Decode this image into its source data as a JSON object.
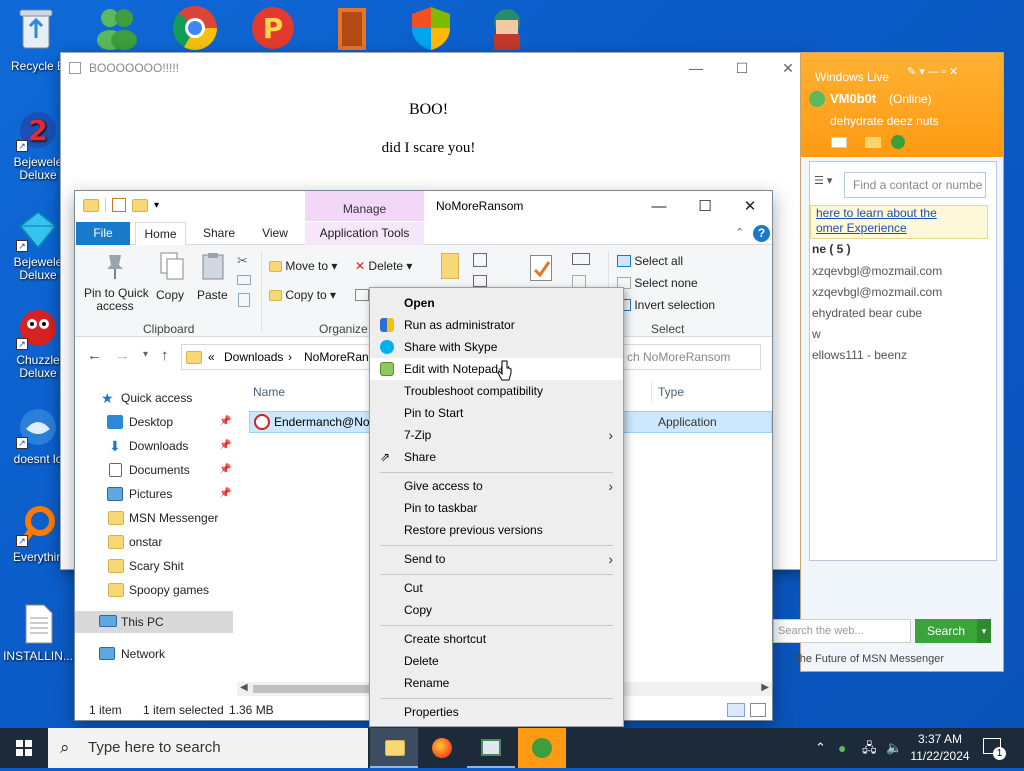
{
  "desktop": {
    "icons": [
      {
        "label": "Recycle B",
        "name": "recycle-bin"
      },
      {
        "label": "Bejeweled Deluxe",
        "name": "bejeweled-2"
      },
      {
        "label": "Bejeweled Deluxe",
        "name": "bejeweled"
      },
      {
        "label": "Chuzzle Deluxe",
        "name": "chuzzle"
      },
      {
        "label": "doesnt lo",
        "name": "doesnt-load"
      },
      {
        "label": "Everythin",
        "name": "everything"
      },
      {
        "label": "INSTALLIN...",
        "name": "installing"
      }
    ],
    "line1": {
      "a": "Bejewele",
      "b": "Deluxe"
    },
    "line2": {
      "a": "Bejewele",
      "b": "Deluxe"
    },
    "line3": {
      "a": "Chuzzle",
      "b": "Deluxe"
    }
  },
  "boo_window": {
    "title": "BOOOOOOO!!!!!",
    "line1": "BOO!",
    "line2": "did I scare you!"
  },
  "msn": {
    "brand": "Windows Live",
    "user": "VM0b0t",
    "status": "(Online)",
    "message": "dehydrate deez nuts",
    "search_placeholder": "Find a contact or numbe",
    "banner1": "here to learn about the",
    "banner2": "omer Experience",
    "group": "ne ( 5 )",
    "contacts": [
      "xzqevbgl@mozmail.com",
      "xzqevbgl@mozmail.com",
      "ehydrated bear cube",
      "w",
      "ellows111 - beenz"
    ],
    "web_search_placeholder": "Search the web...",
    "search_button": "Search",
    "footer": "The Future of MSN Messenger"
  },
  "explorer": {
    "title": "NoMoreRansom",
    "context_tab": "Manage",
    "tabs": {
      "file": "File",
      "home": "Home",
      "share": "Share",
      "view": "View",
      "app_tools": "Application Tools"
    },
    "ribbon": {
      "pin": "Pin to Quick access",
      "pin_a": "Pin to Quick",
      "pin_b": "access",
      "copy": "Copy",
      "paste": "Paste",
      "move_to": "Move to",
      "delete": "Delete",
      "copy_to": "Copy to",
      "select_all": "Select all",
      "select_none": "Select none",
      "invert_selection": "Invert selection",
      "group_clipboard": "Clipboard",
      "group_organize": "Organize",
      "group_select": "Select"
    },
    "breadcrumb": {
      "sep": "«",
      "part1": "Downloads",
      "part2": "NoMoreRans"
    },
    "search_placeholder": "ch NoMoreRansom",
    "columns": {
      "name": "Name",
      "type": "Type"
    },
    "file": {
      "name": "Endermanch@No",
      "type": "Application"
    },
    "nav": {
      "quick_access": "Quick access",
      "items": [
        "Desktop",
        "Downloads",
        "Documents",
        "Pictures",
        "MSN Messenger",
        "onstar",
        "Scary Shit",
        "Spoopy games"
      ],
      "this_pc": "This PC",
      "network": "Network"
    },
    "status": {
      "count": "1 item",
      "selected": "1 item selected",
      "size": "1.36 MB"
    }
  },
  "context_menu": {
    "items": [
      {
        "label": "Open",
        "bold": true
      },
      {
        "label": "Run as administrator"
      },
      {
        "label": "Share with Skype"
      },
      {
        "label": "Edit with Notepad++"
      },
      {
        "label": "Troubleshoot compatibility"
      },
      {
        "label": "Pin to Start"
      },
      {
        "label": "7-Zip"
      },
      {
        "label": "Share"
      },
      {
        "label": "Give access to"
      },
      {
        "label": "Pin to taskbar"
      },
      {
        "label": "Restore previous versions"
      },
      {
        "label": "Send to"
      },
      {
        "label": "Cut"
      },
      {
        "label": "Copy"
      },
      {
        "label": "Create shortcut"
      },
      {
        "label": "Delete"
      },
      {
        "label": "Rename"
      },
      {
        "label": "Properties"
      }
    ]
  },
  "taskbar": {
    "search_placeholder": "Type here to search",
    "time": "3:37 AM",
    "date": "11/22/2024",
    "notification_count": "1"
  },
  "colors": {
    "accent": "#1979ca",
    "msn_orange": "#ff9a12",
    "taskbar": "#1c2a3a"
  }
}
